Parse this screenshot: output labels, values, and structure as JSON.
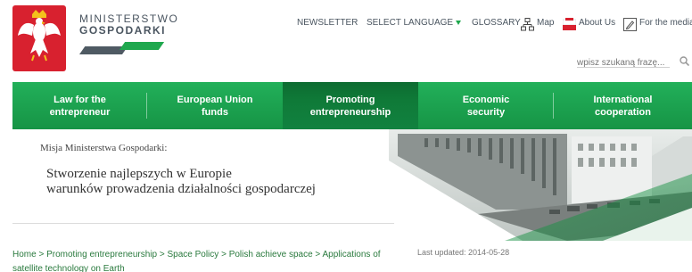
{
  "brand": {
    "line1": "MINISTERSTWO",
    "line2": "GOSPODARKI"
  },
  "top_links": {
    "newsletter": "NEWSLETTER",
    "select_language": "SELECT LANGUAGE",
    "glossary": "GLOSSARY",
    "map": "Map",
    "about": "About Us",
    "media": "For the media"
  },
  "search": {
    "placeholder": "wpisz szukaną frazę..."
  },
  "nav": [
    {
      "label": "Law for the entrepreneur"
    },
    {
      "label": "European Union funds"
    },
    {
      "label": "Promoting entrepreneurship",
      "active": true
    },
    {
      "label": "Economic security"
    },
    {
      "label": "International cooperation"
    }
  ],
  "mission": {
    "label": "Misja Ministerstwa Gospodarki:",
    "line1": "Stworzenie najlepszych w Europie",
    "line2": "warunków prowadzenia działalności gospodarczej"
  },
  "breadcrumb": [
    "Home",
    "Promoting entrepreneurship",
    "Space Policy",
    "Polish achieve space",
    "Applications of satellite technology on Earth"
  ],
  "breadcrumb_separator": ">",
  "last_updated": "Last updated: 2014-05-28",
  "colors": {
    "accent_green": "#1fa84e",
    "nav_active": "#0f7a38",
    "emblem_red": "#d8212f"
  }
}
